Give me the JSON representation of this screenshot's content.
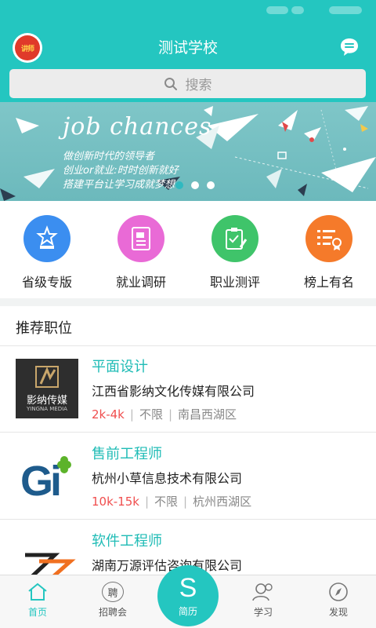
{
  "header": {
    "title": "测试学校",
    "logo_text": "讲师",
    "message_icon": "chat-bubble-icon"
  },
  "search": {
    "placeholder": "搜索",
    "icon": "search-icon"
  },
  "banner": {
    "headline": "job chances",
    "lines": [
      "做创新时代的领导者",
      "创业or就业:时时创新就好",
      "搭建平台让学习成就梦想"
    ],
    "slide_count": 3,
    "active_slide": 1
  },
  "features": [
    {
      "label": "省级专版",
      "icon": "star-trophy-icon",
      "color": "#3b8ef0"
    },
    {
      "label": "就业调研",
      "icon": "document-icon",
      "color": "#e96ad6"
    },
    {
      "label": "职业测评",
      "icon": "clipboard-pen-icon",
      "color": "#3fc46a"
    },
    {
      "label": "榜上有名",
      "icon": "list-badge-icon",
      "color": "#f57a2a"
    }
  ],
  "recommend": {
    "title": "推荐职位",
    "jobs": [
      {
        "title": "平面设计",
        "company": "江西省影纳文化传媒有限公司",
        "salary": "2k-4k",
        "requirement": "不限",
        "location": "南昌西湖区",
        "logo": "yingna-media-logo",
        "logo_text": "影纳传媒",
        "logo_sub": "YINGNA MEDIA"
      },
      {
        "title": "售前工程师",
        "company": "杭州小草信息技术有限公司",
        "salary": "10k-15k",
        "requirement": "不限",
        "location": "杭州西湖区",
        "logo": "gi-logo",
        "logo_text": "Gi"
      },
      {
        "title": "软件工程师",
        "company": "湖南万源评估咨询有限公司",
        "salary": "",
        "requirement": "",
        "location": "",
        "logo": "z-shape-logo"
      }
    ]
  },
  "tabbar": {
    "tabs": [
      {
        "label": "首页",
        "icon": "home-icon"
      },
      {
        "label": "招聘会",
        "icon": "recruit-icon",
        "glyph": "聘"
      },
      {
        "label": "简历",
        "icon": "resume-s-icon",
        "glyph": "S"
      },
      {
        "label": "学习",
        "icon": "study-icon"
      },
      {
        "label": "发现",
        "icon": "compass-icon"
      }
    ],
    "active": 0
  },
  "colors": {
    "primary": "#24c6c0",
    "salary": "#f04e4e"
  }
}
